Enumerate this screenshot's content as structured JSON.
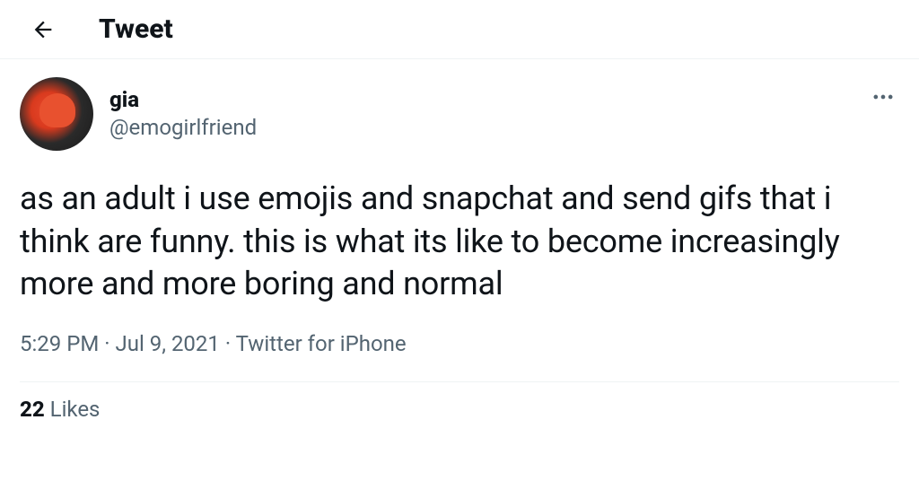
{
  "header": {
    "title": "Tweet"
  },
  "tweet": {
    "user": {
      "display_name": "gia",
      "handle": "@emogirlfriend"
    },
    "text": "as an adult i use emojis and snapchat and send gifs that i think are funny. this is what its like to become increasingly more and more boring and normal",
    "time": "5:29 PM",
    "date": "Jul 9, 2021",
    "source": "Twitter for iPhone",
    "meta_separator": " · ",
    "stats": {
      "likes_count": "22",
      "likes_label": "Likes"
    }
  }
}
